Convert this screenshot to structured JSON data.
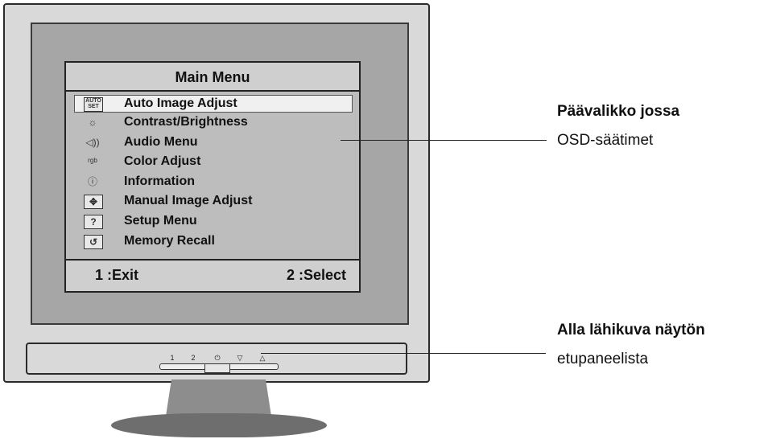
{
  "osd": {
    "title": "Main Menu",
    "items": [
      {
        "icon": "auto-set-icon",
        "icon_text": "AUTO\nSET",
        "label": "Auto Image Adjust",
        "selected": true
      },
      {
        "icon": "sun-icon",
        "icon_text": "☼",
        "label": "Contrast/Brightness"
      },
      {
        "icon": "speaker-icon",
        "icon_text": "◁))",
        "label": "Audio Menu"
      },
      {
        "icon": "color-icon",
        "icon_text": "ʳᵍᵇ",
        "label": "Color Adjust"
      },
      {
        "icon": "info-icon",
        "icon_text": "ⓘ",
        "label": "Information"
      },
      {
        "icon": "move-icon",
        "icon_text": "✥",
        "label": "Manual Image Adjust"
      },
      {
        "icon": "question-icon",
        "icon_text": "?",
        "label": "Setup Menu"
      },
      {
        "icon": "recall-icon",
        "icon_text": "↺",
        "label": "Memory Recall"
      }
    ],
    "footer_exit": "1 :Exit",
    "footer_select": "2 :Select"
  },
  "front_panel": {
    "buttons": [
      {
        "icon": "button-1-icon",
        "glyph": "1"
      },
      {
        "icon": "button-2-icon",
        "glyph": "2"
      },
      {
        "icon": "power-icon",
        "glyph": "⏻"
      },
      {
        "icon": "down-icon",
        "glyph": "▽"
      },
      {
        "icon": "up-icon",
        "glyph": "△"
      }
    ]
  },
  "callouts": {
    "main_menu_title": "Päävalikko jossa",
    "main_menu_sub": "OSD-säätimet",
    "front_panel_title": "Alla lähikuva näytön",
    "front_panel_sub": "etupaneelista"
  }
}
